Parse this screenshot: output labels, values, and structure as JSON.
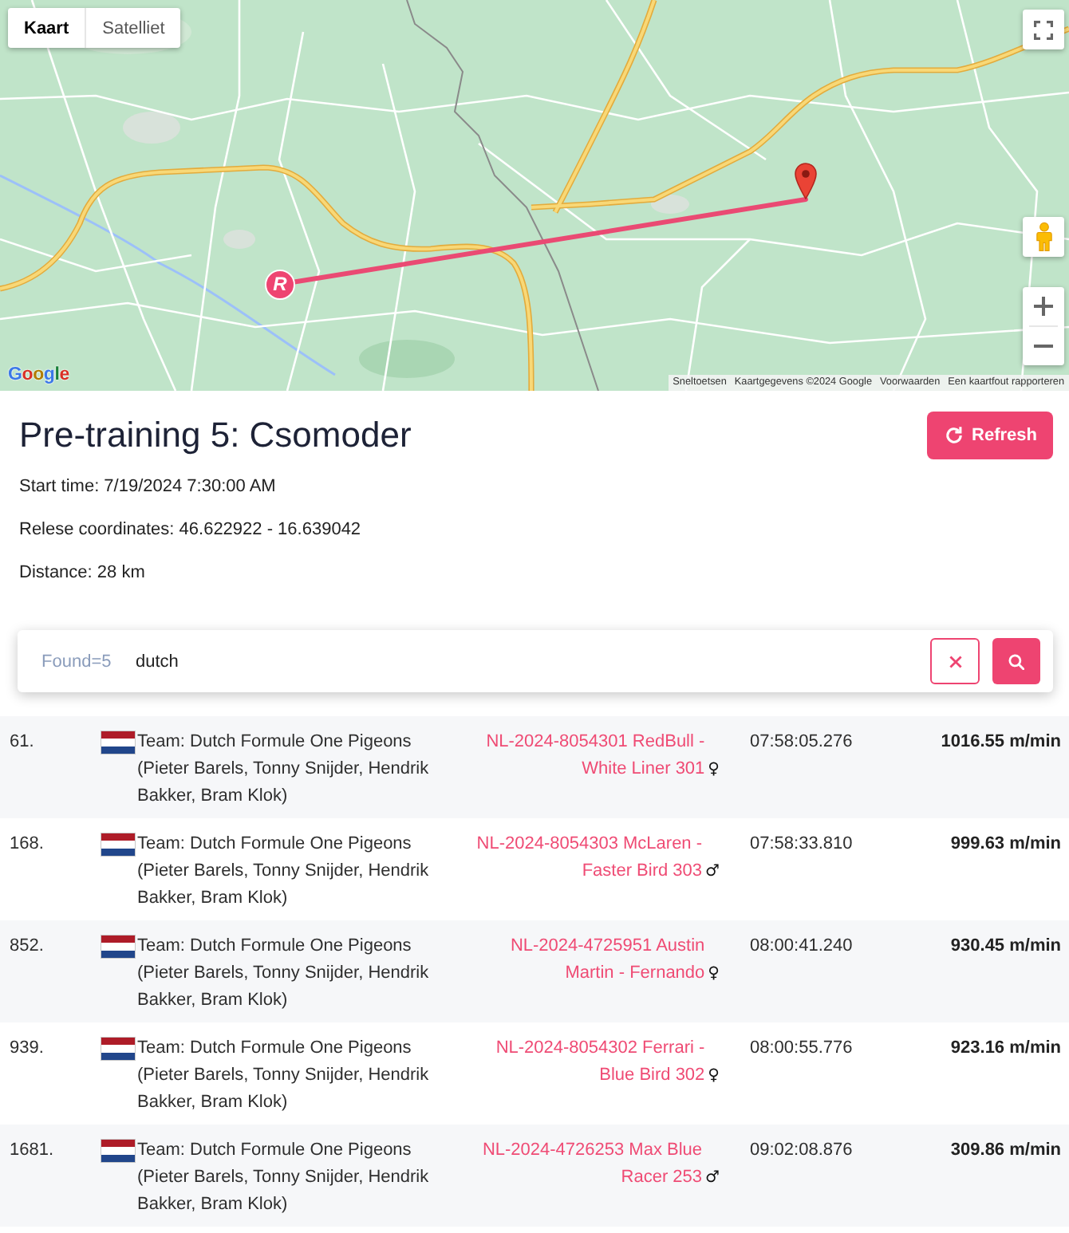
{
  "map": {
    "tabs": [
      {
        "label": "Kaart",
        "selected": true
      },
      {
        "label": "Satelliet",
        "selected": false
      }
    ],
    "start_marker": "R",
    "logo": "Google",
    "attribution": [
      "Sneltoetsen",
      "Kaartgegevens ©2024 Google",
      "Voorwaarden",
      "Een kaartfout rapporteren"
    ]
  },
  "header": {
    "title": "Pre-training 5: Csomoder",
    "refresh_button": "Refresh",
    "details": [
      "Start time: 7/19/2024 7:30:00 AM",
      "Relese coordinates: 46.622922 - 16.639042",
      "Distance: 28 km"
    ]
  },
  "search": {
    "count": "Found=5",
    "value": "dutch"
  },
  "results": [
    {
      "rank": "61.",
      "team": "Team: Dutch Formule One Pigeons (Pieter Barels, Tonny Snijder, Hendrik Bakker, Bram Klok)",
      "pigeon": "NL-2024-8054301 RedBull - White Liner 301",
      "sex": "♀",
      "time": "07:58:05.276",
      "speed": "1016.55 m/min"
    },
    {
      "rank": "168.",
      "team": "Team: Dutch Formule One Pigeons (Pieter Barels, Tonny Snijder, Hendrik Bakker, Bram Klok)",
      "pigeon": "NL-2024-8054303 McLaren - Faster Bird 303",
      "sex": "♂",
      "time": "07:58:33.810",
      "speed": "999.63 m/min"
    },
    {
      "rank": "852.",
      "team": "Team: Dutch Formule One Pigeons (Pieter Barels, Tonny Snijder, Hendrik Bakker, Bram Klok)",
      "pigeon": "NL-2024-4725951 Austin Martin - Fernando",
      "sex": "♀",
      "time": "08:00:41.240",
      "speed": "930.45 m/min"
    },
    {
      "rank": "939.",
      "team": "Team: Dutch Formule One Pigeons (Pieter Barels, Tonny Snijder, Hendrik Bakker, Bram Klok)",
      "pigeon": "NL-2024-8054302 Ferrari - Blue Bird 302",
      "sex": "♀",
      "time": "08:00:55.776",
      "speed": "923.16 m/min"
    },
    {
      "rank": "1681.",
      "team": "Team: Dutch Formule One Pigeons (Pieter Barels, Tonny Snijder, Hendrik Bakker, Bram Klok)",
      "pigeon": "NL-2024-4726253 Max Blue Racer 253",
      "sex": "♂",
      "time": "09:02:08.876",
      "speed": "309.86 m/min"
    }
  ]
}
